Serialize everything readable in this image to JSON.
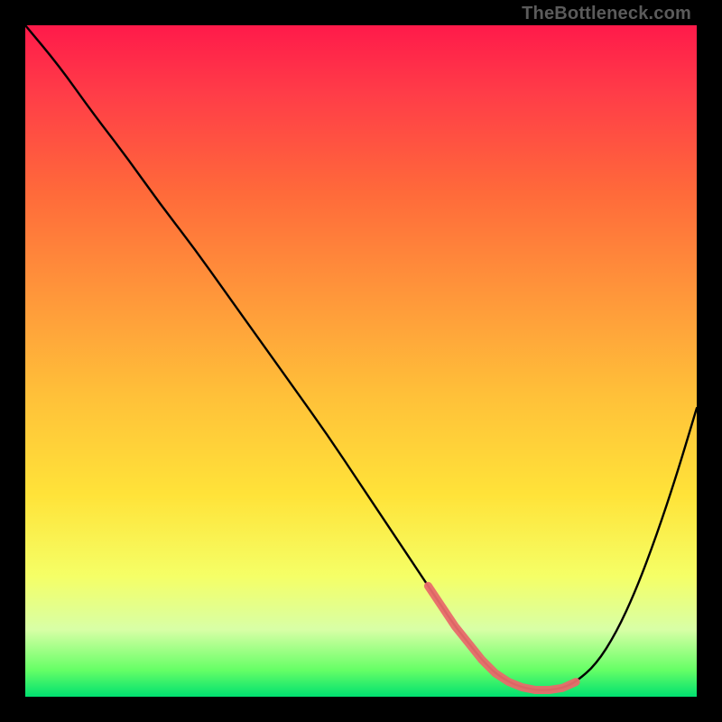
{
  "watermark": "TheBottleneck.com",
  "chart_data": {
    "type": "line",
    "title": "",
    "xlabel": "",
    "ylabel": "",
    "xlim": [
      0,
      100
    ],
    "ylim": [
      0,
      100
    ],
    "x": [
      0,
      5,
      10,
      15,
      20,
      25,
      30,
      35,
      40,
      45,
      50,
      55,
      60,
      62,
      64,
      66,
      68,
      70,
      72,
      74,
      76,
      78,
      80,
      82,
      85,
      88,
      91,
      94,
      97,
      100
    ],
    "values": [
      100,
      94,
      87,
      80.5,
      73.5,
      67,
      60,
      53,
      46,
      39,
      31.5,
      24,
      16.5,
      13.5,
      10.5,
      8,
      5.5,
      3.5,
      2.2,
      1.4,
      1,
      1,
      1.3,
      2.2,
      4.8,
      9.5,
      16,
      24,
      33,
      43
    ],
    "highlight_range_x": [
      60,
      82
    ],
    "gradient_colors": [
      "#ff1a4a",
      "#ffe339",
      "#00e070"
    ]
  }
}
